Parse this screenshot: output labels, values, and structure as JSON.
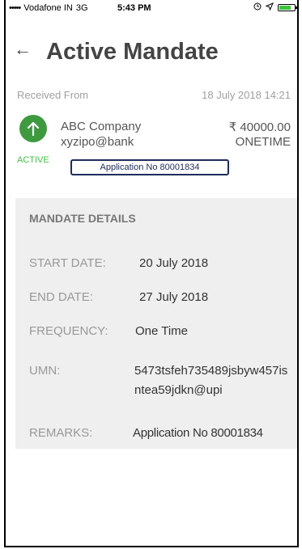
{
  "status_bar": {
    "signal": "•••••",
    "carrier": "Vodafone IN",
    "network": "3G",
    "time": "5:43 PM",
    "icons": [
      "alarm-icon",
      "location-arrow-icon",
      "battery-icon"
    ],
    "battery_level": 0.8
  },
  "header": {
    "back_icon": "←",
    "title": "Active Mandate"
  },
  "received": {
    "label": "Received From",
    "datetime": "18 July 2018 14:21"
  },
  "payee": {
    "name": "ABC Company",
    "vpa": "xyzipo@bank",
    "amount": "₹ 40000.00",
    "type": "ONETIME",
    "status": "ACTIVE",
    "status_color": "#46c146",
    "icon_color": "#3f9a3f",
    "application": "Application No 80001834"
  },
  "details": {
    "heading": "MANDATE DETAILS",
    "rows": [
      {
        "label": "START DATE:",
        "value": "20 July 2018"
      },
      {
        "label": "END DATE:",
        "value": "27 July 2018"
      },
      {
        "label": "FREQUENCY:",
        "value": "One Time"
      },
      {
        "label": "UMN:",
        "value": "5473tsfeh735489jsbyw457isntea59jdkn@upi"
      },
      {
        "label": "REMARKS:",
        "value": "Application No 80001834"
      }
    ]
  }
}
